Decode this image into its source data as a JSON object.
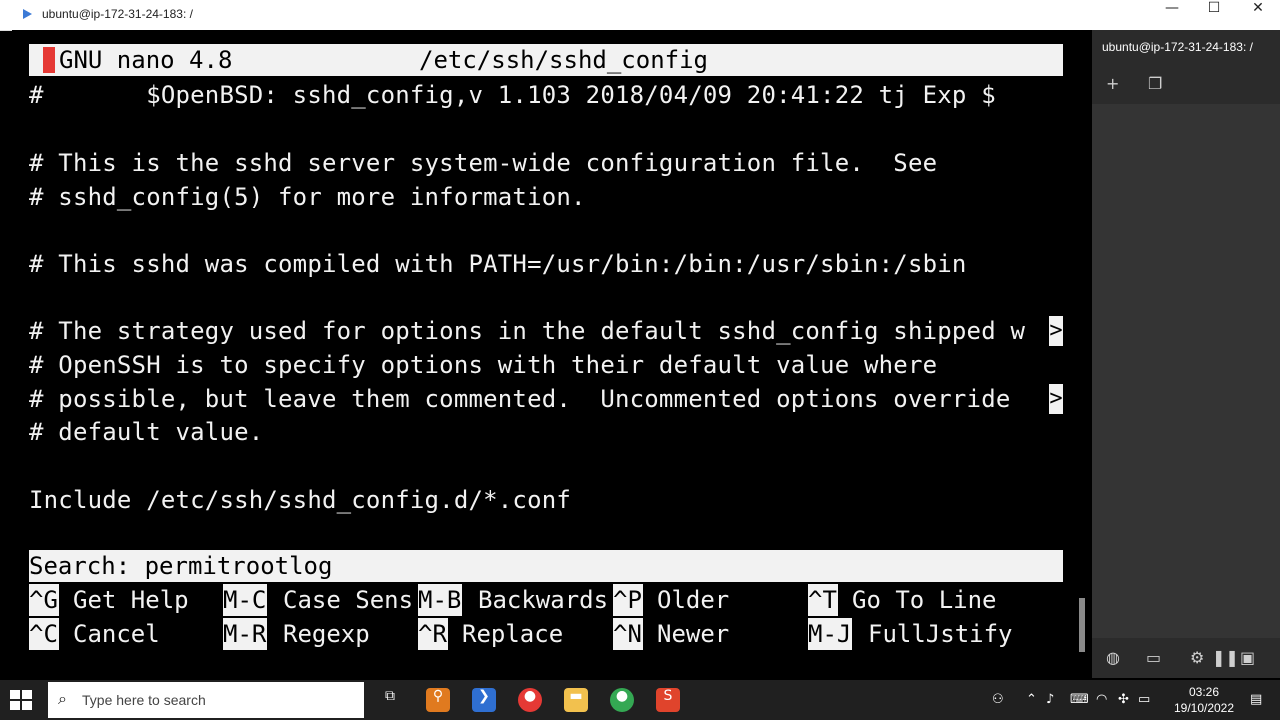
{
  "window": {
    "title": "ubuntu@ip-172-31-24-183: /",
    "min": "—",
    "max": "☐",
    "close": "✕"
  },
  "nano": {
    "version": "GNU nano 4.8",
    "file": "/etc/ssh/sshd_config",
    "lines": [
      "#       $OpenBSD: sshd_config,v 1.103 2018/04/09 20:41:22 tj Exp $",
      "",
      "# This is the sshd server system-wide configuration file.  See",
      "# sshd_config(5) for more information.",
      "",
      "# This sshd was compiled with PATH=/usr/bin:/bin:/usr/sbin:/sbin",
      "",
      "# The strategy used for options in the default sshd_config shipped w",
      "# OpenSSH is to specify options with their default value where",
      "# possible, but leave them commented.  Uncommented options override ",
      "# default value.",
      "",
      "Include /etc/ssh/sshd_config.d/*.conf"
    ],
    "search_prompt": "Search: permitrootlog",
    "shortcuts": [
      {
        "key": "^G",
        "label": "Get Help"
      },
      {
        "key": "^C",
        "label": "Cancel"
      },
      {
        "key": "M-C",
        "label": "Case Sens"
      },
      {
        "key": "M-R",
        "label": "Regexp"
      },
      {
        "key": "M-B",
        "label": "Backwards"
      },
      {
        "key": "^R",
        "label": "Replace"
      },
      {
        "key": "^P",
        "label": "Older"
      },
      {
        "key": "^N",
        "label": "Newer"
      },
      {
        "key": "^T",
        "label": "Go To Line"
      },
      {
        "key": "M-J",
        "label": "FullJstify"
      }
    ]
  },
  "panel": {
    "title": "ubuntu@ip-172-31-24-183: /"
  },
  "taskbar": {
    "search_placeholder": "Type here to search",
    "time": "03:26",
    "date": "19/10/2022"
  }
}
